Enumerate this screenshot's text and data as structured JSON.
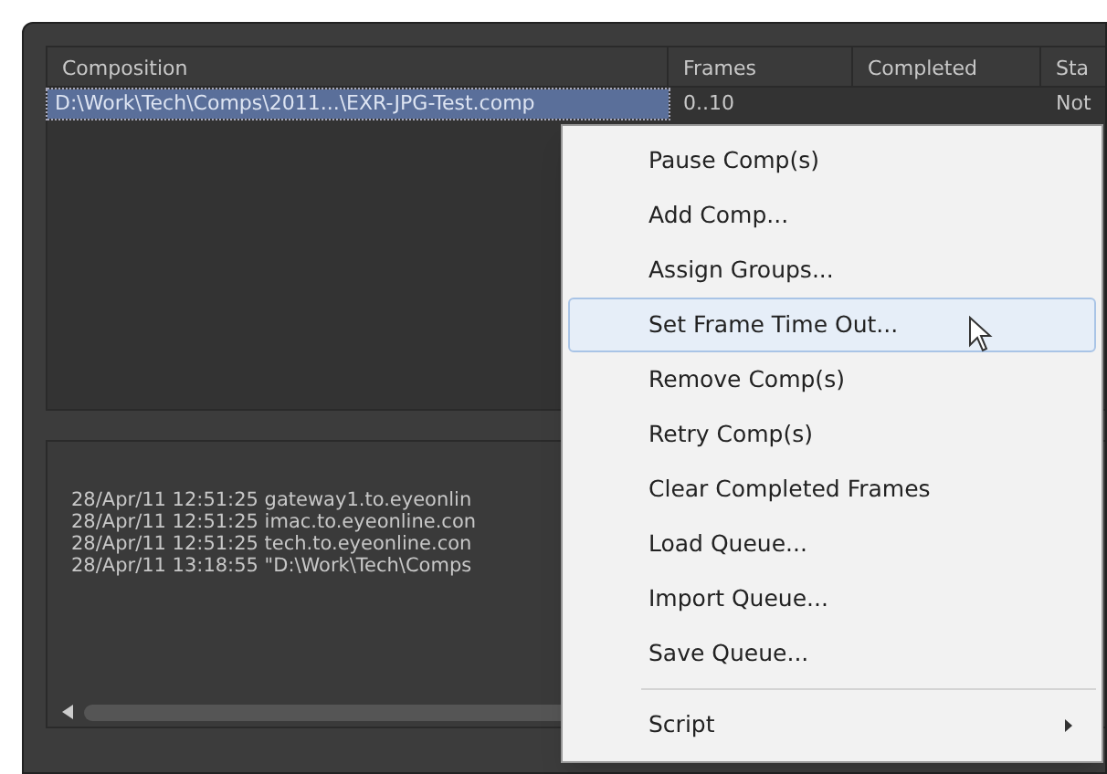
{
  "table": {
    "columns": [
      "Composition",
      "Frames",
      "Completed",
      "Sta"
    ],
    "rows": [
      {
        "composition": "D:\\Work\\Tech\\Comps\\2011...\\EXR-JPG-Test.comp",
        "frames": "0..10",
        "status": "Not",
        "selected": true
      }
    ]
  },
  "log": [
    "28/Apr/11 12:51:25 gateway1.to.eyeonlin",
    "28/Apr/11 12:51:25 imac.to.eyeonline.con",
    "28/Apr/11 12:51:25 tech.to.eyeonline.con",
    "28/Apr/11 13:18:55 \"D:\\Work\\Tech\\Comps"
  ],
  "context_menu": [
    {
      "label": "Pause Comp(s)",
      "selected": false
    },
    {
      "label": "Add Comp...",
      "selected": false
    },
    {
      "label": "Assign Groups...",
      "selected": false
    },
    {
      "label": "Set Frame Time Out...",
      "selected": true
    },
    {
      "label": "Remove Comp(s)",
      "selected": false
    },
    {
      "label": "Retry Comp(s)",
      "selected": false
    },
    {
      "label": "Clear Completed Frames",
      "selected": false
    },
    {
      "label": "Load Queue...",
      "selected": false
    },
    {
      "label": "Import Queue...",
      "selected": false
    },
    {
      "label": "Save Queue...",
      "selected": false
    },
    {
      "label": "Script",
      "selected": false,
      "kind": "submenu",
      "separator_before": true
    }
  ]
}
